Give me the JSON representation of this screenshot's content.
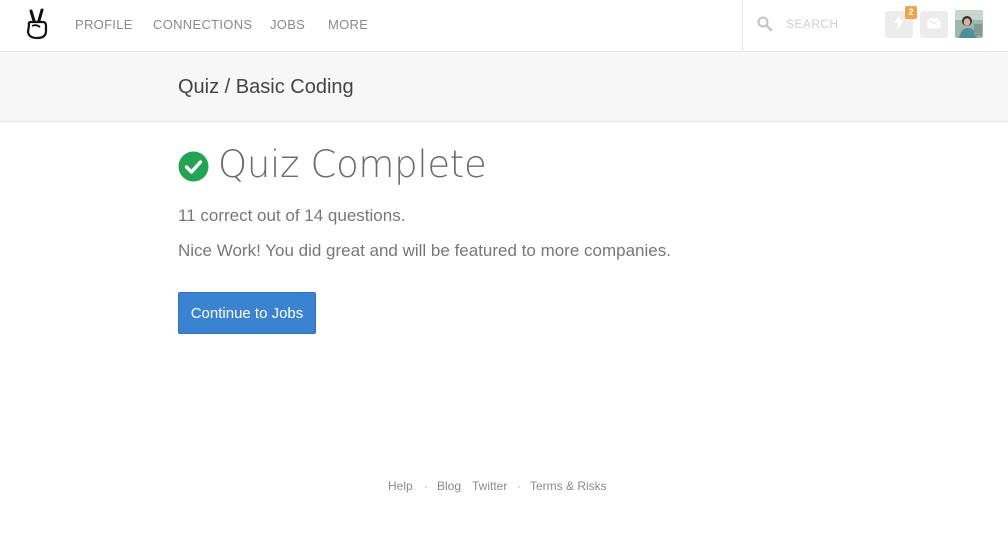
{
  "nav": {
    "items": [
      {
        "label": "PROFILE"
      },
      {
        "label": "CONNECTIONS"
      },
      {
        "label": "JOBS"
      },
      {
        "label": "MORE"
      }
    ],
    "search": {
      "placeholder": "SEARCH",
      "value": ""
    },
    "notifications": {
      "count": "2",
      "icon": "lightning-icon"
    },
    "messages": {
      "icon": "envelope-icon"
    },
    "logo_icon": "peace-hand-icon"
  },
  "page": {
    "breadcrumb": "Quiz / Basic Coding",
    "title": "Quiz Complete",
    "score_text": "11 correct out of 14 questions.",
    "message": "Nice Work! You did great and will be featured to more companies.",
    "continue_label": "Continue to Jobs"
  },
  "footer": {
    "links": [
      "Help",
      "Blog",
      "Twitter",
      "Terms & Risks"
    ],
    "separator": "·"
  },
  "colors": {
    "accent": "#3b82d0",
    "success": "#23a455",
    "badge": "#f2a24a"
  }
}
